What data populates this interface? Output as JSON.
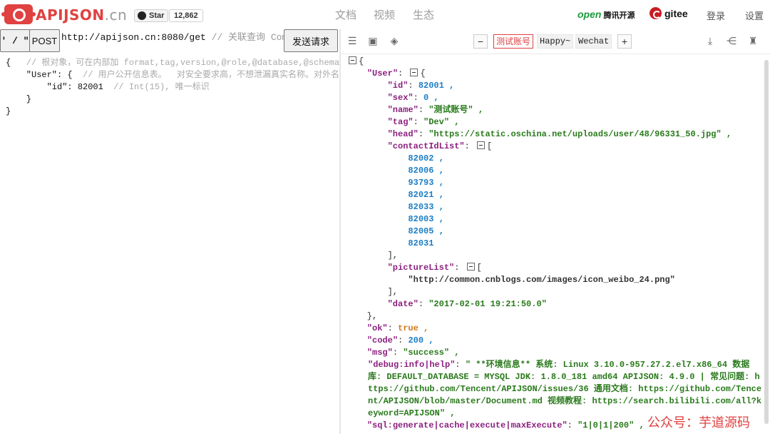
{
  "topbar": {
    "brand_main": "APIJSON",
    "brand_suffix": ".cn",
    "star_label": "Star",
    "star_count": "12,862",
    "nav": [
      "文档",
      "视频",
      "生态"
    ],
    "opensource_logo_text": "腾讯开源",
    "opensource_logo_brand": "open",
    "gitee_label": "gitee",
    "login": "登录",
    "settings": "设置"
  },
  "request": {
    "slash_label": "' / \"",
    "method": "POST",
    "url": "http://apijson.cn:8080/get",
    "url_comment": "// 关联查询 Comment",
    "send_label": "发送请求",
    "lines": [
      {
        "prefix": "{   ",
        "comment": "// 根对象，可在内部加 format,tag,version,@role,@database,@schema,"
      },
      {
        "prefix": "    \"User\": {  ",
        "comment": "// 用户公开信息表。  对安全要求高，不想泄漏真实名称。对外名称"
      },
      {
        "prefix": "        \"id\": 82001  ",
        "comment": "// Int(15), 唯一标识"
      },
      {
        "prefix": "    }",
        "comment": ""
      },
      {
        "prefix": "}",
        "comment": ""
      }
    ]
  },
  "response": {
    "accounts": [
      "测试账号",
      "Happy~",
      "Wechat"
    ],
    "active_account": "测试账号",
    "user": {
      "id": "82001",
      "sex": "0",
      "name": "\"测试账号\"",
      "tag": "\"Dev\"",
      "head": "\"https://static.oschina.net/uploads/user/48/96331_50.jpg\"",
      "contactIdList": [
        "82002",
        "82006",
        "93793",
        "82021",
        "82033",
        "82003",
        "82005",
        "82031"
      ],
      "pictureList": [
        "\"http://common.cnblogs.com/images/icon_weibo_24.png\""
      ],
      "date": "\"2017-02-01 19:21:50.0\""
    },
    "ok": "true",
    "code": "200",
    "msg": "\"success\"",
    "debug_key": "\"debug:info|help\"",
    "debug_value": "\" **环境信息** 系统: Linux 3.10.0-957.27.2.el7.x86_64 数据库: DEFAULT_DATABASE = MYSQL JDK: 1.8.0_181 amd64 APIJSON: 4.9.0 | 常见问题: https://github.com/Tencent/APIJSON/issues/36 通用文档: https://github.com/Tencent/APIJSON/blob/master/Document.md 视频教程: https://search.bilibili.com/all?keyword=APIJSON\"",
    "sql_key": "\"sql:generate|cache|execute|maxExecute\"",
    "sql_value": "\"1|0|1|200\""
  },
  "watermark": "公众号：芋道源码",
  "colors": {
    "brand_red": "#e04141",
    "json_key": "#8b1f7e",
    "json_string": "#2a7a1c",
    "json_number": "#1c7ec5",
    "json_bool": "#d07919"
  }
}
